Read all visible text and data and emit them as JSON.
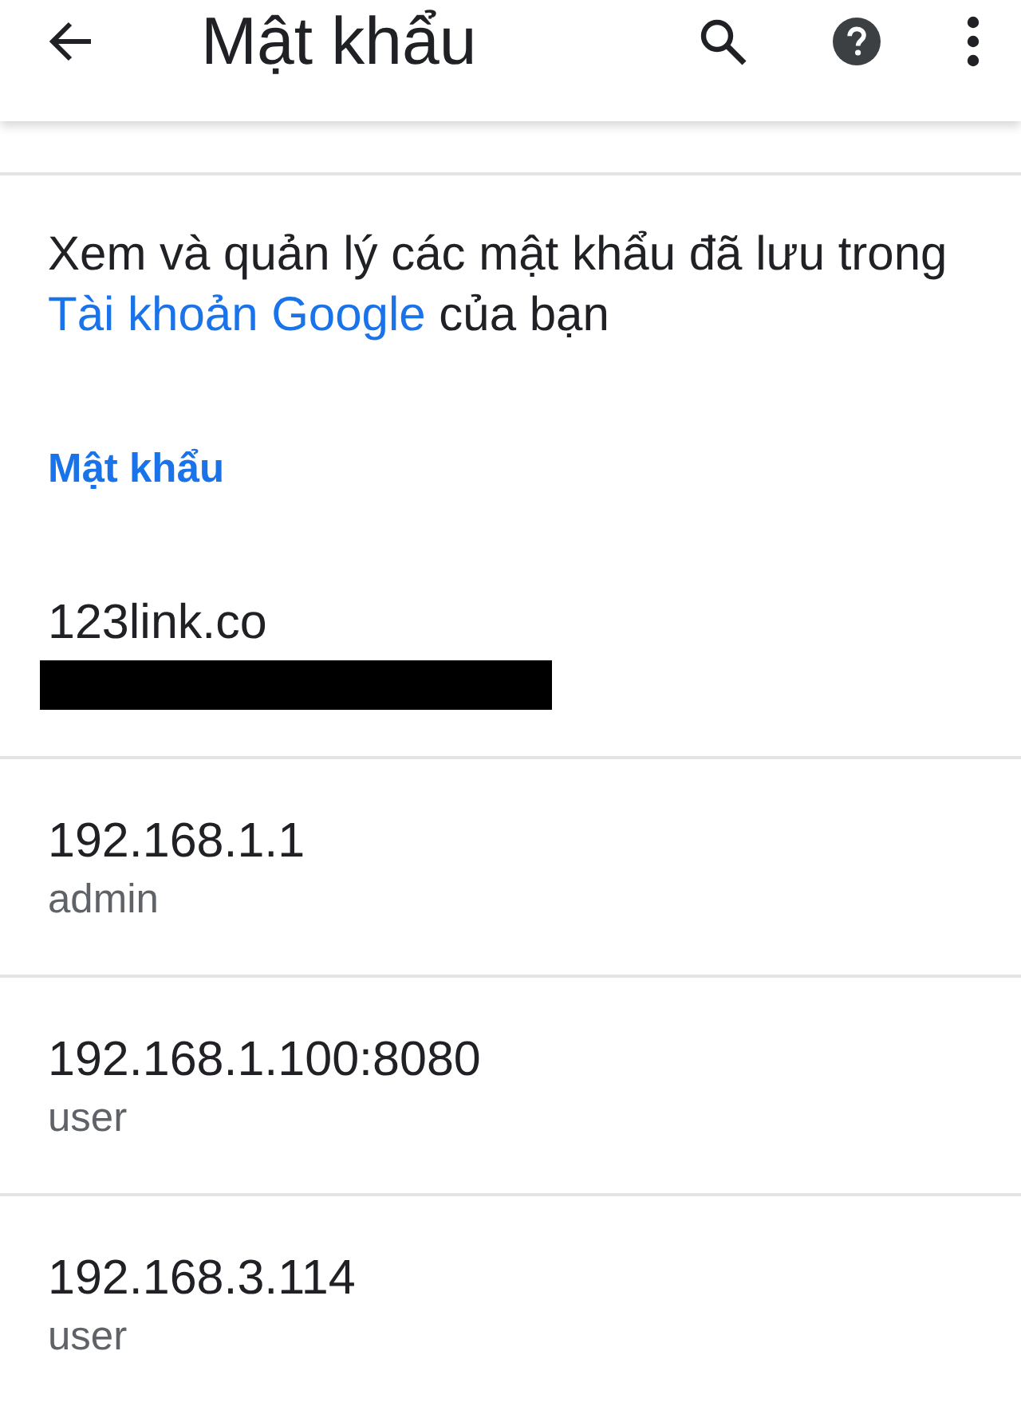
{
  "app_bar": {
    "title": "Mật khẩu"
  },
  "description": {
    "text_before": "Xem và quản lý các mật khẩu đã lưu trong",
    "link": "Tài khoản Google",
    "text_after": "của bạn"
  },
  "section": {
    "title": "Mật khẩu"
  },
  "passwords": [
    {
      "site": "123link.co",
      "redacted": true
    },
    {
      "site": "192.168.1.1",
      "username": "admin",
      "redacted": false
    },
    {
      "site": "192.168.1.100:8080",
      "username": "user",
      "redacted": false
    },
    {
      "site": "192.168.3.114",
      "username": "user",
      "redacted": false
    }
  ]
}
